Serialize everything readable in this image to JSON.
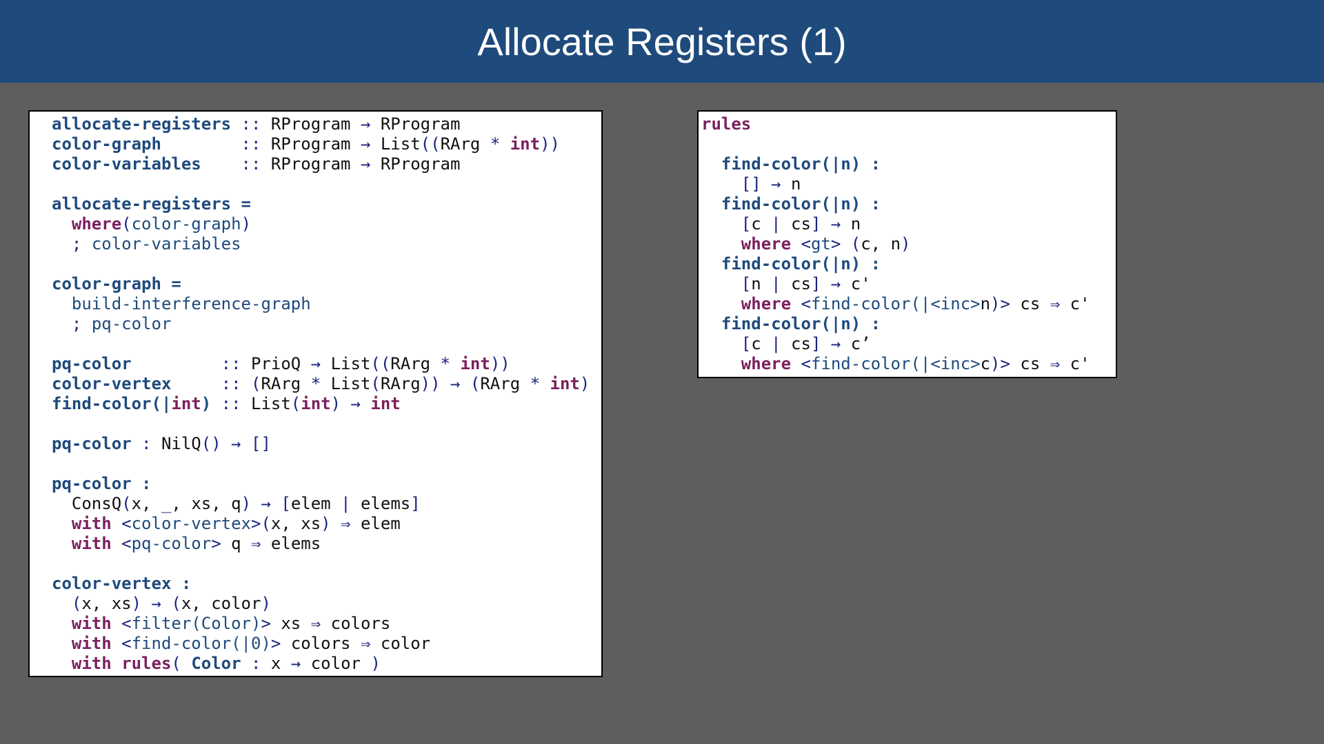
{
  "slide": {
    "title": "Allocate Registers (1)"
  },
  "colors": {
    "header_bg": "#1e4a7c",
    "page_bg": "#5e5e5e",
    "panel_bg": "#ffffff",
    "definition": "#1e4a7c",
    "keyword": "#7b1f5e",
    "operator": "#1a237e",
    "identifier": "#1e4a7c",
    "plain": "#111111"
  },
  "left_code": [
    [
      [
        "def",
        "allocate-registers"
      ],
      [
        "op",
        " :: "
      ],
      [
        "plain",
        "RProgram "
      ],
      [
        "op",
        "→"
      ],
      [
        "plain",
        " RProgram"
      ]
    ],
    [
      [
        "def",
        "color-graph"
      ],
      [
        "op",
        "        :: "
      ],
      [
        "plain",
        "RProgram "
      ],
      [
        "op",
        "→"
      ],
      [
        "plain",
        " List"
      ],
      [
        "op",
        "(("
      ],
      [
        "plain",
        "RArg "
      ],
      [
        "op",
        "*"
      ],
      [
        "plain",
        " "
      ],
      [
        "kw",
        "int"
      ],
      [
        "op",
        "))"
      ]
    ],
    [
      [
        "def",
        "color-variables"
      ],
      [
        "op",
        "    :: "
      ],
      [
        "plain",
        "RProgram "
      ],
      [
        "op",
        "→"
      ],
      [
        "plain",
        " RProgram"
      ]
    ],
    [],
    [
      [
        "def",
        "allocate-registers ="
      ]
    ],
    [
      [
        "plain",
        "  "
      ],
      [
        "kw",
        "where"
      ],
      [
        "op",
        "("
      ],
      [
        "id",
        "color-graph"
      ],
      [
        "op",
        ")"
      ]
    ],
    [
      [
        "plain",
        "  "
      ],
      [
        "op",
        "; "
      ],
      [
        "id",
        "color-variables"
      ]
    ],
    [],
    [
      [
        "def",
        "color-graph ="
      ]
    ],
    [
      [
        "plain",
        "  "
      ],
      [
        "id",
        "build-interference-graph"
      ]
    ],
    [
      [
        "plain",
        "  "
      ],
      [
        "op",
        "; "
      ],
      [
        "id",
        "pq-color"
      ]
    ],
    [],
    [
      [
        "def",
        "pq-color"
      ],
      [
        "op",
        "         :: "
      ],
      [
        "plain",
        "PrioQ "
      ],
      [
        "op",
        "→"
      ],
      [
        "plain",
        " List"
      ],
      [
        "op",
        "(("
      ],
      [
        "plain",
        "RArg "
      ],
      [
        "op",
        "*"
      ],
      [
        "plain",
        " "
      ],
      [
        "kw",
        "int"
      ],
      [
        "op",
        "))"
      ]
    ],
    [
      [
        "def",
        "color-vertex"
      ],
      [
        "op",
        "     :: ("
      ],
      [
        "plain",
        "RArg "
      ],
      [
        "op",
        "*"
      ],
      [
        "plain",
        " List"
      ],
      [
        "op",
        "("
      ],
      [
        "plain",
        "RArg"
      ],
      [
        "op",
        ")) → ("
      ],
      [
        "plain",
        "RArg "
      ],
      [
        "op",
        "*"
      ],
      [
        "plain",
        " "
      ],
      [
        "kw",
        "int"
      ],
      [
        "op",
        ")"
      ]
    ],
    [
      [
        "def",
        "find-color(|"
      ],
      [
        "kw",
        "int"
      ],
      [
        "def",
        ")"
      ],
      [
        "op",
        " :: "
      ],
      [
        "plain",
        "List"
      ],
      [
        "op",
        "("
      ],
      [
        "kw",
        "int"
      ],
      [
        "op",
        ") → "
      ],
      [
        "kw",
        "int"
      ]
    ],
    [],
    [
      [
        "def",
        "pq-color"
      ],
      [
        "op",
        " : "
      ],
      [
        "plain",
        "NilQ"
      ],
      [
        "op",
        "() → []"
      ]
    ],
    [],
    [
      [
        "def",
        "pq-color :"
      ]
    ],
    [
      [
        "plain",
        "  ConsQ"
      ],
      [
        "op",
        "("
      ],
      [
        "plain",
        "x, "
      ],
      [
        "op",
        "_"
      ],
      [
        "plain",
        ", xs, q"
      ],
      [
        "op",
        ") → ["
      ],
      [
        "plain",
        "elem "
      ],
      [
        "op",
        "|"
      ],
      [
        "plain",
        " elems"
      ],
      [
        "op",
        "]"
      ]
    ],
    [
      [
        "plain",
        "  "
      ],
      [
        "kw",
        "with"
      ],
      [
        "op",
        " <"
      ],
      [
        "id",
        "color-vertex"
      ],
      [
        "op",
        ">("
      ],
      [
        "plain",
        "x, xs"
      ],
      [
        "op",
        ") ⇒ "
      ],
      [
        "plain",
        "elem"
      ]
    ],
    [
      [
        "plain",
        "  "
      ],
      [
        "kw",
        "with"
      ],
      [
        "op",
        " <"
      ],
      [
        "id",
        "pq-color"
      ],
      [
        "op",
        "> "
      ],
      [
        "plain",
        "q "
      ],
      [
        "op",
        "⇒ "
      ],
      [
        "plain",
        "elems"
      ]
    ],
    [],
    [
      [
        "def",
        "color-vertex :"
      ]
    ],
    [
      [
        "plain",
        "  "
      ],
      [
        "op",
        "("
      ],
      [
        "plain",
        "x, xs"
      ],
      [
        "op",
        ") → ("
      ],
      [
        "plain",
        "x, color"
      ],
      [
        "op",
        ")"
      ]
    ],
    [
      [
        "plain",
        "  "
      ],
      [
        "kw",
        "with"
      ],
      [
        "op",
        " <"
      ],
      [
        "id",
        "filter(Color)"
      ],
      [
        "op",
        "> "
      ],
      [
        "plain",
        "xs "
      ],
      [
        "op",
        "⇒ "
      ],
      [
        "plain",
        "colors"
      ]
    ],
    [
      [
        "plain",
        "  "
      ],
      [
        "kw",
        "with"
      ],
      [
        "op",
        " <"
      ],
      [
        "id",
        "find-color(|0)"
      ],
      [
        "op",
        "> "
      ],
      [
        "plain",
        "colors "
      ],
      [
        "op",
        "⇒ "
      ],
      [
        "plain",
        "color"
      ]
    ],
    [
      [
        "plain",
        "  "
      ],
      [
        "kw",
        "with rules"
      ],
      [
        "op",
        "( "
      ],
      [
        "def",
        "Color"
      ],
      [
        "op",
        " : "
      ],
      [
        "plain",
        "x "
      ],
      [
        "op",
        "→ "
      ],
      [
        "plain",
        "color "
      ],
      [
        "op",
        ")"
      ]
    ]
  ],
  "right_code": [
    [
      [
        "kw",
        "rules"
      ]
    ],
    [],
    [
      [
        "plain",
        "  "
      ],
      [
        "def",
        "find-color(|n) :"
      ]
    ],
    [
      [
        "plain",
        "    "
      ],
      [
        "op",
        "[] → "
      ],
      [
        "plain",
        "n"
      ]
    ],
    [
      [
        "plain",
        "  "
      ],
      [
        "def",
        "find-color(|n) :"
      ]
    ],
    [
      [
        "plain",
        "    "
      ],
      [
        "op",
        "["
      ],
      [
        "plain",
        "c "
      ],
      [
        "op",
        "|"
      ],
      [
        "plain",
        " cs"
      ],
      [
        "op",
        "] → "
      ],
      [
        "plain",
        "n"
      ]
    ],
    [
      [
        "plain",
        "    "
      ],
      [
        "kw",
        "where"
      ],
      [
        "op",
        " <"
      ],
      [
        "id",
        "gt"
      ],
      [
        "op",
        "> ("
      ],
      [
        "plain",
        "c, n"
      ],
      [
        "op",
        ")"
      ]
    ],
    [
      [
        "plain",
        "  "
      ],
      [
        "def",
        "find-color(|n) :"
      ]
    ],
    [
      [
        "plain",
        "    "
      ],
      [
        "op",
        "["
      ],
      [
        "plain",
        "n "
      ],
      [
        "op",
        "|"
      ],
      [
        "plain",
        " cs"
      ],
      [
        "op",
        "] → "
      ],
      [
        "plain",
        "c'"
      ]
    ],
    [
      [
        "plain",
        "    "
      ],
      [
        "kw",
        "where"
      ],
      [
        "op",
        " <"
      ],
      [
        "id",
        "find-color(|<inc>"
      ],
      [
        "plain",
        "n"
      ],
      [
        "op",
        ")> "
      ],
      [
        "plain",
        "cs "
      ],
      [
        "op",
        "⇒ "
      ],
      [
        "plain",
        "c'"
      ]
    ],
    [
      [
        "plain",
        "  "
      ],
      [
        "def",
        "find-color(|n) :"
      ]
    ],
    [
      [
        "plain",
        "    "
      ],
      [
        "op",
        "["
      ],
      [
        "plain",
        "c "
      ],
      [
        "op",
        "|"
      ],
      [
        "plain",
        " cs"
      ],
      [
        "op",
        "] → "
      ],
      [
        "plain",
        "c’"
      ]
    ],
    [
      [
        "plain",
        "    "
      ],
      [
        "kw",
        "where"
      ],
      [
        "op",
        " <"
      ],
      [
        "id",
        "find-color(|<inc>"
      ],
      [
        "plain",
        "c"
      ],
      [
        "op",
        ")> "
      ],
      [
        "plain",
        "cs "
      ],
      [
        "op",
        "⇒ "
      ],
      [
        "plain",
        "c'"
      ]
    ]
  ]
}
